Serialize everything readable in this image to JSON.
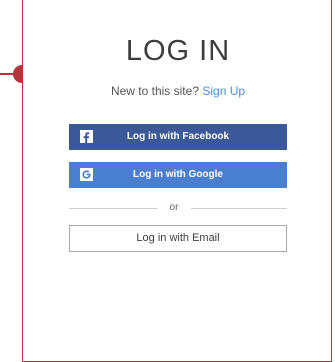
{
  "login": {
    "title": "LOG IN",
    "signup_prompt": "New to this site?",
    "signup_link": "Sign Up",
    "facebook_button": "Log in with Facebook",
    "google_button": "Log in with Google",
    "divider_text": "or",
    "email_button": "Log in with Email"
  },
  "colors": {
    "accent_red": "#b8313b",
    "facebook_blue": "#3b5998",
    "google_blue": "#4a7fcf",
    "link_blue": "#4b8fd9"
  },
  "icons": {
    "facebook": "facebook-icon",
    "google": "google-icon"
  }
}
